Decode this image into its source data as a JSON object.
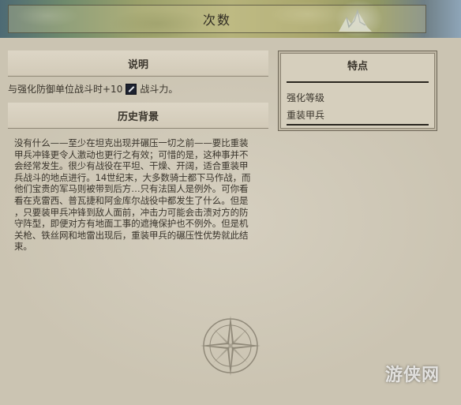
{
  "window": {
    "title": "次数"
  },
  "description": {
    "heading": "说明",
    "text_before_icon": "与强化防御单位战斗时+10",
    "icon": "sword-strength-icon",
    "text_after_icon": "战斗力。"
  },
  "history": {
    "heading": "历史背景",
    "text": "没有什么——至少在坦克出现并碾压一切之前——要比重装\n甲兵冲锋更令人激动也更行之有效；可惜的是，这种事并不\n会经常发生。很少有战役在平坦、干燥、开阔，适合重装甲\n兵战斗的地点进行。14世纪末，大多数骑士都下马作战，而\n他们宝贵的军马则被带到后方…只有法国人是例外。可你看\n看在克雷西、普瓦捷和阿金库尔战役中都发生了什么。但是\n，只要装甲兵冲锋到敌人面前，冲击力可能会击溃对方的防\n守阵型，即便对方有地面工事的遮掩保护也不例外。但是机\n关枪、铁丝网和地雷出现后，重装甲兵的碾压性优势就此结\n束。"
  },
  "traits": {
    "heading": "特点",
    "items": [
      "强化等级",
      "重装甲兵"
    ]
  },
  "decor": {
    "compass": "compass-rose-icon"
  },
  "watermark": {
    "text": "游侠网"
  }
}
